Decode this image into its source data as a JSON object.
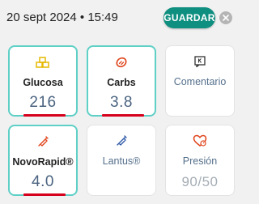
{
  "header": {
    "datetime": "20 sept 2024 • 15:49",
    "save_label": "GUARDAR",
    "accent_color": "#0f8f80"
  },
  "cards": [
    {
      "label": "Glucosa",
      "value": "216",
      "icon": "blocks-icon",
      "active": true
    },
    {
      "label": "Carbs",
      "value": "3.8",
      "icon": "bread-icon",
      "active": true
    },
    {
      "label": "Comentario",
      "value": "",
      "icon": "comment-icon",
      "active": false
    },
    {
      "label": "NovoRapid®",
      "value": "4.0",
      "icon": "syringe-icon",
      "active": true
    },
    {
      "label": "Lantus®",
      "value": "",
      "icon": "syringe-icon",
      "active": false
    },
    {
      "label": "Presión",
      "value": "90/50",
      "icon": "heart-pressure-icon",
      "active": false
    }
  ]
}
